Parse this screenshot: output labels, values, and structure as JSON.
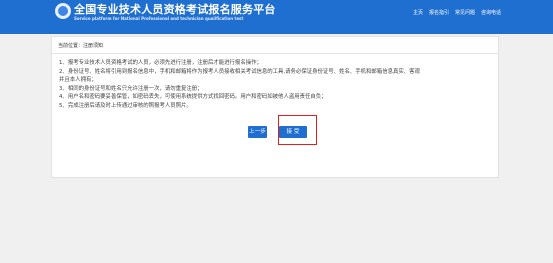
{
  "header": {
    "title": "全国专业技术人员资格考试报名服务平台",
    "subtitle": "Service platform for National Professional and technician qualification test",
    "nav": [
      "主页",
      "报名指引",
      "常见问题",
      "咨询电话"
    ],
    "bg_color": "#1f6fd1"
  },
  "breadcrumb": "当前位置：注册须知",
  "notice": [
    "1、报考专业技术人员资格考试的人员，必须先进行注册，注册后才能进行报名操作；",
    "2、身份证号、姓名将引用到报名信息中，手机和邮箱将作为报考人员接收相关考试信息的工具,请务必保证身份证号、姓名、手机和邮箱信息真实、客观",
    "并且本人拥有；",
    "3、相同的身份证号和姓名只允许注册一次，请勿重复注册；",
    "4、用户名和密码要妥善保管，如密码丢失，可使用系统提供方式找回密码。用户和密码如被他人盗用责任自负；",
    "5、完成注册后请及时上传通过审核的照报考人员照片。"
  ],
  "buttons": {
    "prev": "上一步",
    "accept": "接  受"
  },
  "accent_color": "#1f6fd1",
  "highlight_color": "#e02020"
}
